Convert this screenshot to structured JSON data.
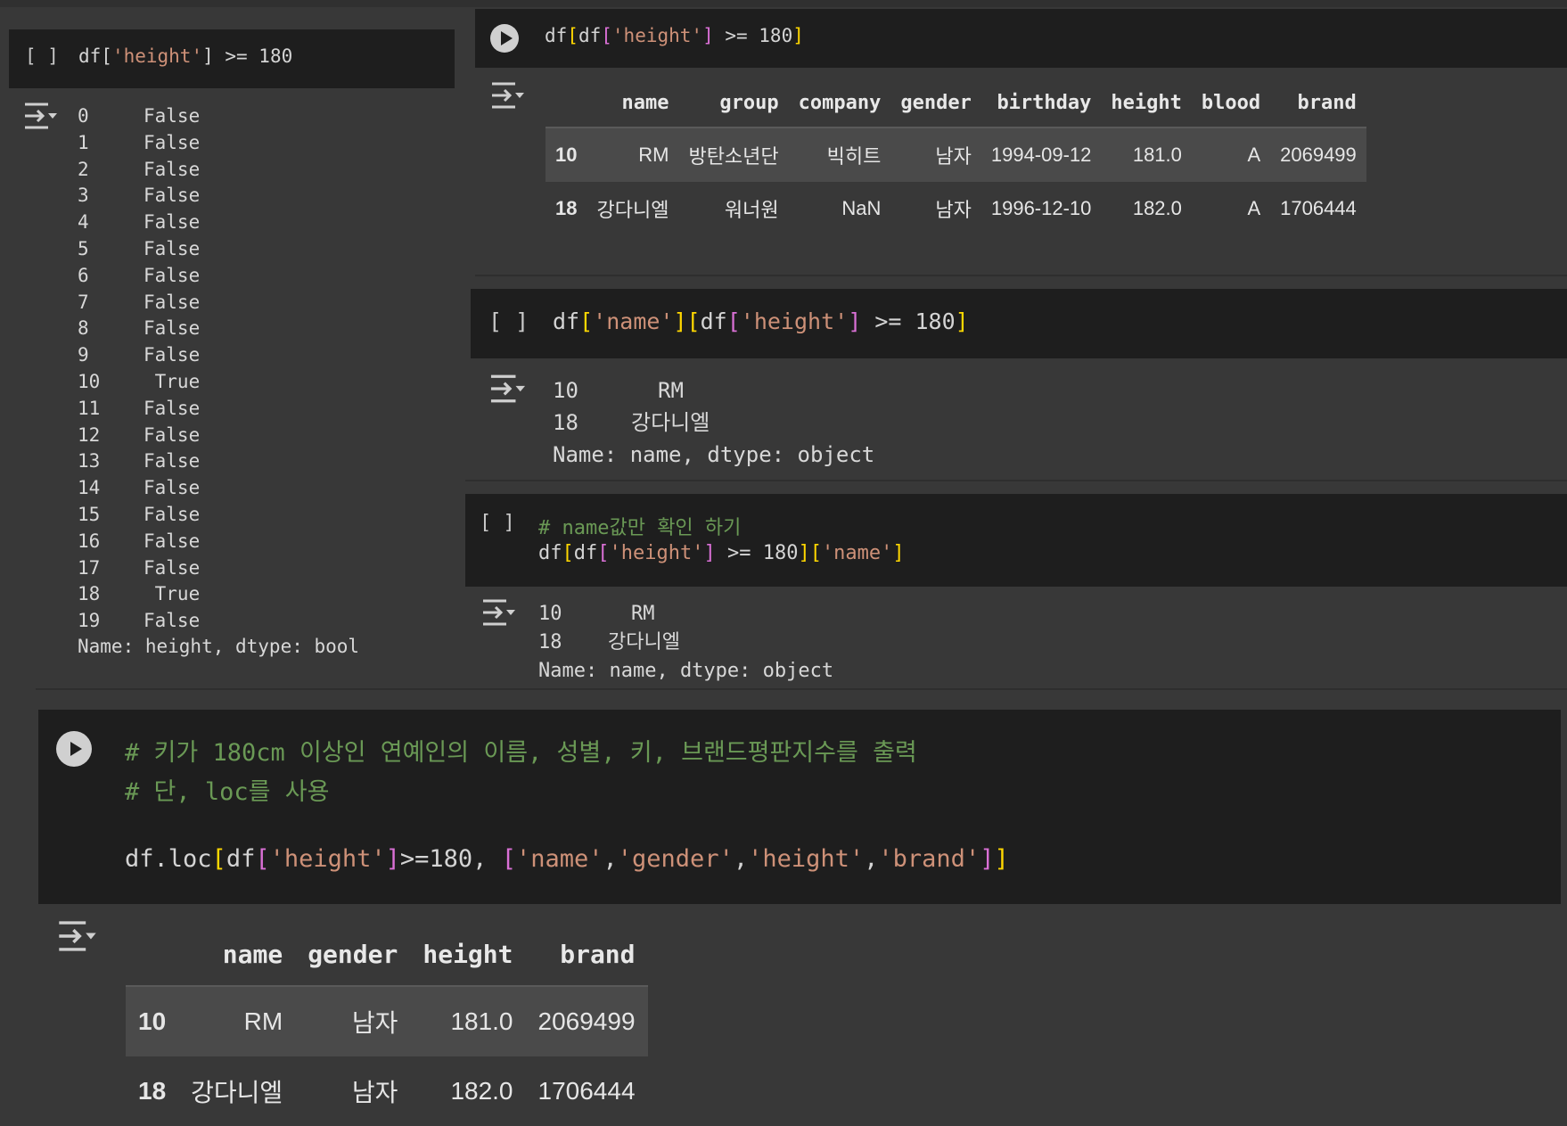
{
  "cell1": {
    "code": {
      "p1": "df[",
      "s1": "'height'",
      "p2": "] >= 180"
    },
    "bracket": "[ ]",
    "series": [
      {
        "i": "0",
        "v": "False"
      },
      {
        "i": "1",
        "v": "False"
      },
      {
        "i": "2",
        "v": "False"
      },
      {
        "i": "3",
        "v": "False"
      },
      {
        "i": "4",
        "v": "False"
      },
      {
        "i": "5",
        "v": "False"
      },
      {
        "i": "6",
        "v": "False"
      },
      {
        "i": "7",
        "v": "False"
      },
      {
        "i": "8",
        "v": "False"
      },
      {
        "i": "9",
        "v": "False"
      },
      {
        "i": "10",
        "v": " True"
      },
      {
        "i": "11",
        "v": "False"
      },
      {
        "i": "12",
        "v": "False"
      },
      {
        "i": "13",
        "v": "False"
      },
      {
        "i": "14",
        "v": "False"
      },
      {
        "i": "15",
        "v": "False"
      },
      {
        "i": "16",
        "v": "False"
      },
      {
        "i": "17",
        "v": "False"
      },
      {
        "i": "18",
        "v": " True"
      },
      {
        "i": "19",
        "v": "False"
      }
    ],
    "footer": "Name: height, dtype: bool"
  },
  "cell2": {
    "code": {
      "p1": "df",
      "b1": "[",
      "p2": "df",
      "b2": "[",
      "s1": "'height'",
      "b3": "]",
      "p3": " >= 180",
      "b4": "]"
    },
    "table": {
      "headers": [
        "",
        "name",
        "group",
        "company",
        "gender",
        "birthday",
        "height",
        "blood",
        "brand"
      ],
      "rows": [
        [
          "10",
          "RM",
          "방탄소년단",
          "빅히트",
          "남자",
          "1994-09-12",
          "181.0",
          "A",
          "2069499"
        ],
        [
          "18",
          "강다니엘",
          "워너원",
          "NaN",
          "남자",
          "1996-12-10",
          "182.0",
          "A",
          "1706444"
        ]
      ]
    }
  },
  "cell3": {
    "bracket": "[ ]",
    "code": {
      "p1": "df",
      "b1": "[",
      "s1": "'name'",
      "b2": "]",
      "b3": "[",
      "p2": "df",
      "b4": "[",
      "s2": "'height'",
      "b5": "]",
      "p3": " >= 180",
      "b6": "]"
    },
    "out": [
      {
        "i": "10",
        "v": "RM"
      },
      {
        "i": "18",
        "v": "강다니엘"
      }
    ],
    "footer": "Name: name, dtype: object"
  },
  "cell4": {
    "bracket": "[ ]",
    "comment": "# name값만 확인 하기",
    "code": {
      "p1": "df",
      "b1": "[",
      "p2": "df",
      "b2": "[",
      "s1": "'height'",
      "b3": "]",
      "p3": " >= 180",
      "b4": "]",
      "b5": "[",
      "s2": "'name'",
      "b6": "]"
    },
    "out": [
      {
        "i": "10",
        "v": "RM"
      },
      {
        "i": "18",
        "v": "강다니엘"
      }
    ],
    "footer": "Name: name, dtype: object"
  },
  "cell5": {
    "comment1": "# 키가 180cm 이상인 연예인의 이름, 성별, 키, 브랜드평판지수를 출력",
    "comment2": "# 단, loc를 사용",
    "code": {
      "p1": "df.loc",
      "b1": "[",
      "p2": "df",
      "b2": "[",
      "s1": "'height'",
      "b3": "]",
      "p3": ">=180, ",
      "b4": "[",
      "s2": "'name'",
      "c1": ",",
      "s3": "'gender'",
      "c2": ",",
      "s4": "'height'",
      "c3": ",",
      "s5": "'brand'",
      "b5": "]",
      "b6": "]"
    },
    "table": {
      "headers": [
        "",
        "name",
        "gender",
        "height",
        "brand"
      ],
      "rows": [
        [
          "10",
          "RM",
          "남자",
          "181.0",
          "2069499"
        ],
        [
          "18",
          "강다니엘",
          "남자",
          "182.0",
          "1706444"
        ]
      ]
    }
  },
  "icons": {
    "run": "play-icon",
    "output": "output-toggle-icon"
  }
}
